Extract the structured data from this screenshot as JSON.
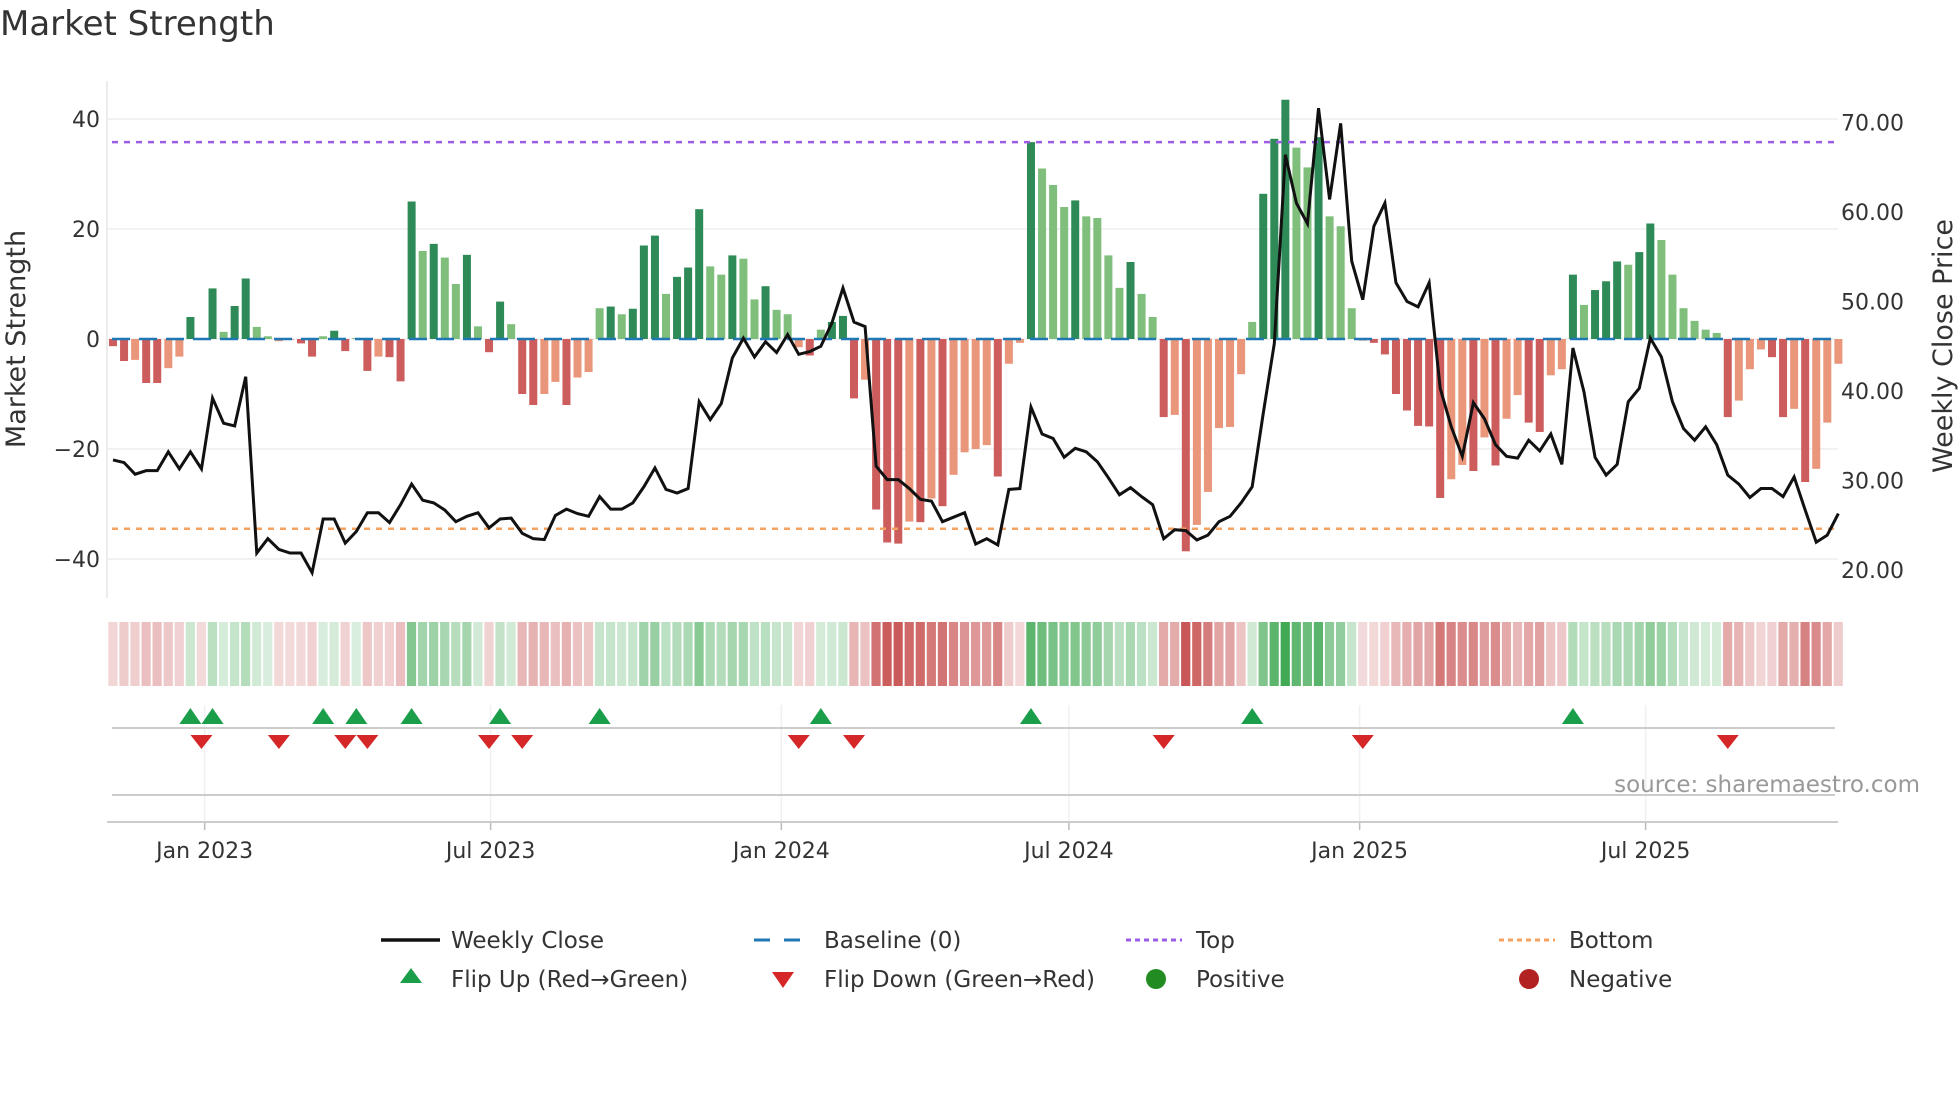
{
  "chart_data": {
    "type": "bar+line",
    "title": "Market Strength",
    "ylabel": "Market Strength",
    "y2label": "Weekly Close Price",
    "ylim": [
      -43,
      47
    ],
    "y2lim": [
      17.5,
      75.5
    ],
    "yticks": [
      -40,
      -20,
      0,
      20,
      40
    ],
    "yticklabels": [
      "−40",
      "−20",
      "0",
      "20",
      "40"
    ],
    "y2ticks": [
      20,
      30,
      40,
      50,
      60,
      70
    ],
    "y2ticklabels": [
      "20.00",
      "30.00",
      "40.00",
      "50.00",
      "60.00",
      "70.00"
    ],
    "x_start": "2022-11-04",
    "x_step_days": 7,
    "xticks": [
      {
        "date": "2023-01-01",
        "label": "Jan 2023"
      },
      {
        "date": "2023-07-01",
        "label": "Jul 2023"
      },
      {
        "date": "2024-01-01",
        "label": "Jan 2024"
      },
      {
        "date": "2024-07-01",
        "label": "Jul 2024"
      },
      {
        "date": "2025-01-01",
        "label": "Jan 2025"
      },
      {
        "date": "2025-07-01",
        "label": "Jul 2025"
      }
    ],
    "top": 35.8,
    "bottom": -34.5,
    "baseline": 0,
    "strength": [
      -1.3,
      -4,
      -3.8,
      -8,
      -8,
      -5.3,
      -3.2,
      4,
      -0.2,
      9.2,
      1.3,
      6,
      11,
      2.2,
      0.5,
      -0.4,
      -0.1,
      -0.8,
      -3.2,
      0.5,
      1.5,
      -2.2,
      0.2,
      -5.8,
      -3.2,
      -3.3,
      -7.7,
      25,
      16,
      17.3,
      14.8,
      10,
      15.3,
      2.3,
      -2.4,
      6.8,
      2.7,
      -10,
      -12,
      -10,
      -7.8,
      -12,
      -7,
      -6,
      5.6,
      5.9,
      4.5,
      5.5,
      17,
      18.8,
      8.2,
      11.3,
      13,
      23.6,
      13.2,
      11.7,
      15.2,
      14.6,
      7.2,
      9.6,
      5.3,
      4.5,
      -1.5,
      -3,
      1.7,
      3.1,
      4.2,
      -10.8,
      -7.4,
      -31,
      -37,
      -37.2,
      -33.2,
      -33.3,
      -29,
      -30.4,
      -24.7,
      -20.6,
      -20,
      -19.3,
      -25,
      -4.5,
      -0.7,
      35.8,
      31,
      28,
      24,
      25.2,
      22.3,
      22,
      15.2,
      9.3,
      14,
      8.2,
      4,
      -14.2,
      -13.8,
      -38.6,
      -33.8,
      -27.8,
      -16.2,
      -16,
      -6.4,
      3.1,
      26.4,
      36.4,
      43.5,
      34.8,
      31.2,
      36.7,
      22.3,
      20.5,
      5.6,
      -0.3,
      -0.7,
      -2.8,
      -10,
      -13,
      -15.8,
      -15.9,
      -28.9,
      -25.5,
      -22.9,
      -24,
      -17.9,
      -23,
      -14.5,
      -10.2,
      -15.2,
      -16.9,
      -6.6,
      -5.5,
      11.7,
      6.2,
      8.9,
      10.5,
      14.1,
      13.5,
      15.8,
      21,
      18,
      11.7,
      5.6,
      3.3,
      1.7,
      1.1,
      -14.2,
      -11.2,
      -5.5,
      -1.9,
      -3.3,
      -14.2,
      -12.7,
      -26,
      -23.6,
      -15.2,
      -4.5
    ],
    "close": [
      32.3,
      32.0,
      30.7,
      31.1,
      31.1,
      33.2,
      31.3,
      33.2,
      31.3,
      39.2,
      36.4,
      36.1,
      41.6,
      21.9,
      23.5,
      22.3,
      21.9,
      21.9,
      19.7,
      25.7,
      25.7,
      23.0,
      24.3,
      26.4,
      26.4,
      25.3,
      27.3,
      29.6,
      27.8,
      27.5,
      26.7,
      25.4,
      26.0,
      26.4,
      24.7,
      25.7,
      25.8,
      24.1,
      23.5,
      23.4,
      26.1,
      26.8,
      26.3,
      26.0,
      28.2,
      26.8,
      26.8,
      27.5,
      29.3,
      31.4,
      29.0,
      28.6,
      29.1,
      38.8,
      36.8,
      38.6,
      43.7,
      45.9,
      43.8,
      45.5,
      44.3,
      46.3,
      44.1,
      44.4,
      45.0,
      47.6,
      51.5,
      47.7,
      47.2,
      31.6,
      30.1,
      30.1,
      29.1,
      27.9,
      27.7,
      25.4,
      25.9,
      26.4,
      22.9,
      23.5,
      22.8,
      29.0,
      29.1,
      38.2,
      35.2,
      34.7,
      32.6,
      33.6,
      33.2,
      32.1,
      30.3,
      28.4,
      29.2,
      28.2,
      27.3,
      23.5,
      24.5,
      24.4,
      23.35,
      23.9,
      25.4,
      26.0,
      27.5,
      29.3,
      37.5,
      45.3,
      66.4,
      61.0,
      58.7,
      71.6,
      61.4,
      69.9,
      54.5,
      50.2,
      58.4,
      61.0,
      52.1,
      50.0,
      49.4,
      52.1,
      40.3,
      36.0,
      32.7,
      38.7,
      36.9,
      34.0,
      32.7,
      32.5,
      34.5,
      33.3,
      35.2,
      31.8,
      44.8,
      39.9,
      32.6,
      30.6,
      31.8,
      38.8,
      40.3,
      45.9,
      43.8,
      38.8,
      35.8,
      34.5,
      36.0,
      34.0,
      30.6,
      29.6,
      28.1,
      29.1,
      29.1,
      28.2,
      30.4,
      26.7,
      23.1,
      23.9,
      26.3
    ],
    "colors": {
      "pos_strong": "#2e8b57",
      "pos_weak": "#7fbf7b",
      "neg_strong": "#cd5c5c",
      "neg_weak": "#e9967a",
      "close": "#111111",
      "baseline": "#1f77b4",
      "top": "#9b5de5",
      "bottom": "#f4a261",
      "flip_up": "#1a9e4a",
      "flip_down": "#d62728",
      "positive": "#228b22",
      "negative": "#b22222"
    },
    "legend": {
      "placement": "bottom",
      "items": [
        {
          "key": "close",
          "label": "Weekly Close"
        },
        {
          "key": "baseline",
          "label": "Baseline (0)"
        },
        {
          "key": "top",
          "label": "Top"
        },
        {
          "key": "bottom",
          "label": "Bottom"
        },
        {
          "key": "flip_up",
          "label": "Flip Up (Red→Green)"
        },
        {
          "key": "flip_down",
          "label": "Flip Down (Green→Red)"
        },
        {
          "key": "positive",
          "label": "Positive"
        },
        {
          "key": "negative",
          "label": "Negative"
        }
      ]
    },
    "source": "source: sharemaestro.com"
  }
}
